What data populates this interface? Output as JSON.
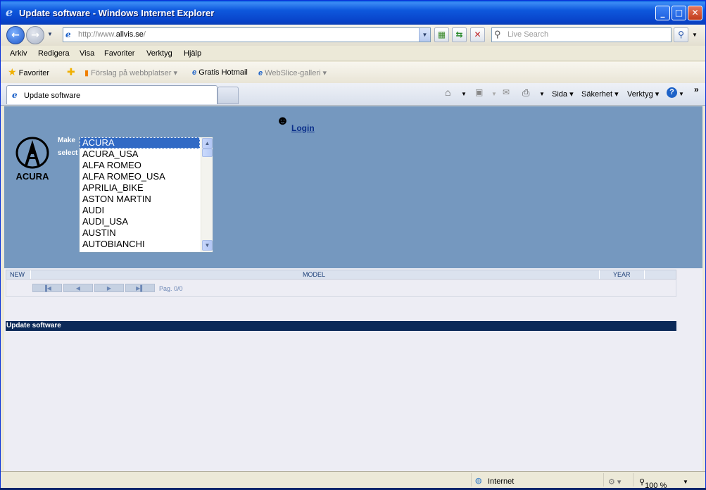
{
  "window": {
    "title": "Update software - Windows Internet Explorer"
  },
  "address": {
    "url_prefix": "http://www.",
    "url_host": "allvis.se",
    "url_suffix": "/"
  },
  "search": {
    "placeholder": "Live Search"
  },
  "menu": [
    "Arkiv",
    "Redigera",
    "Visa",
    "Favoriter",
    "Verktyg",
    "Hjälp"
  ],
  "favorites": {
    "label": "Favoriter",
    "items": [
      "Förslag på webbplatser",
      "Gratis Hotmail",
      "WebSlice-galleri"
    ]
  },
  "tab": {
    "title": "Update software"
  },
  "commands": {
    "page": "Sida",
    "safety": "Säkerhet",
    "tools": "Verktyg"
  },
  "page": {
    "login_label": "Login",
    "logo_text": "ACURA",
    "make_label": "Make",
    "select_label": "select",
    "makes": [
      "ACURA",
      "ACURA_USA",
      "ALFA ROMEO",
      "ALFA ROMEO_USA",
      "APRILIA_BIKE",
      "ASTON MARTIN",
      "AUDI",
      "AUDI_USA",
      "AUSTIN",
      "AUTOBIANCHI"
    ],
    "selected_make": "ACURA",
    "grid": {
      "col_new": "NEW",
      "col_model": "MODEL",
      "col_year": "YEAR"
    },
    "pagination": "Pag. 0/0",
    "footer": "Update software"
  },
  "status": {
    "zone": "Internet",
    "zoom": "100 %"
  }
}
